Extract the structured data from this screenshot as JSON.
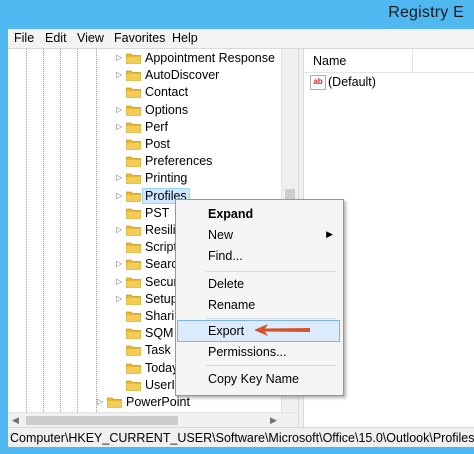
{
  "window": {
    "title": "Registry E"
  },
  "menu": [
    "File",
    "Edit",
    "View",
    "Favorites",
    "Help"
  ],
  "tree": {
    "items": [
      {
        "label": "Appointment Response",
        "arrow": "▷"
      },
      {
        "label": "AutoDiscover",
        "arrow": "▷"
      },
      {
        "label": "Contact",
        "arrow": ""
      },
      {
        "label": "Options",
        "arrow": "▷"
      },
      {
        "label": "Perf",
        "arrow": "▷"
      },
      {
        "label": "Post",
        "arrow": ""
      },
      {
        "label": "Preferences",
        "arrow": ""
      },
      {
        "label": "Printing",
        "arrow": "▷"
      },
      {
        "label": "Profiles",
        "arrow": "▷",
        "selected": true
      },
      {
        "label": "PST",
        "arrow": ""
      },
      {
        "label": "Resilie",
        "arrow": "▷"
      },
      {
        "label": "Scripti",
        "arrow": ""
      },
      {
        "label": "Search",
        "arrow": "▷"
      },
      {
        "label": "Securi",
        "arrow": "▷"
      },
      {
        "label": "Setup",
        "arrow": "▷"
      },
      {
        "label": "Sharin",
        "arrow": ""
      },
      {
        "label": "SQM",
        "arrow": ""
      },
      {
        "label": "Task",
        "arrow": ""
      },
      {
        "label": "Today",
        "arrow": ""
      },
      {
        "label": "UserIn",
        "arrow": ""
      }
    ],
    "powerpoint": {
      "label": "PowerPoint",
      "arrow": "▷"
    }
  },
  "values": {
    "column_name": "Name",
    "rows": [
      {
        "name": "(Default)"
      }
    ]
  },
  "context_menu": {
    "expand": "Expand",
    "new": "New",
    "new_arrow": "▶",
    "find": "Find...",
    "delete": "Delete",
    "rename": "Rename",
    "export": "Export",
    "permissions": "Permissions...",
    "copy_key_name": "Copy Key Name"
  },
  "status": {
    "path": "Computer\\HKEY_CURRENT_USER\\Software\\Microsoft\\Office\\15.0\\Outlook\\Profiles"
  },
  "colors": {
    "frame": "#4fb8f0",
    "folder": "#e8b830",
    "highlight": "#dcebfc",
    "annotation_arrow": "#d2552a"
  }
}
